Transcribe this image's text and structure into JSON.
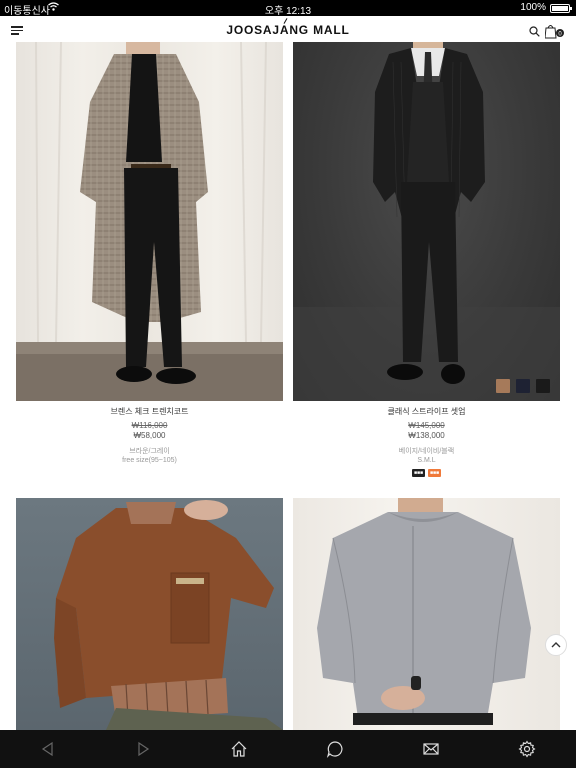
{
  "status_bar": {
    "carrier": "이동통신사",
    "time": "오후 12:13",
    "battery": "100%"
  },
  "header": {
    "logo": "JOOSAJANG MALL",
    "cart_count": "0",
    "icons": [
      "menu-icon",
      "search-icon",
      "cart-icon"
    ]
  },
  "products": [
    {
      "name": "브렌스 체크 트렌치코트",
      "price_original": "₩116,000",
      "price_sale": "₩58,000",
      "colors": "브라운/그레이",
      "sizes": "free size(95~105)"
    },
    {
      "name": "클래식 스트라이프 셋업",
      "price_original": "₩145,000",
      "price_sale": "₩138,000",
      "colors": "베이지/네이비/블랙",
      "sizes": "S.M.L",
      "swatch_colors": [
        "#a67a5a",
        "#1e2233",
        "#1a1a1a"
      ]
    }
  ],
  "bottom_bar": {
    "icons": [
      "back-icon",
      "forward-icon",
      "home-icon",
      "chat-icon",
      "mail-icon",
      "settings-icon"
    ]
  }
}
